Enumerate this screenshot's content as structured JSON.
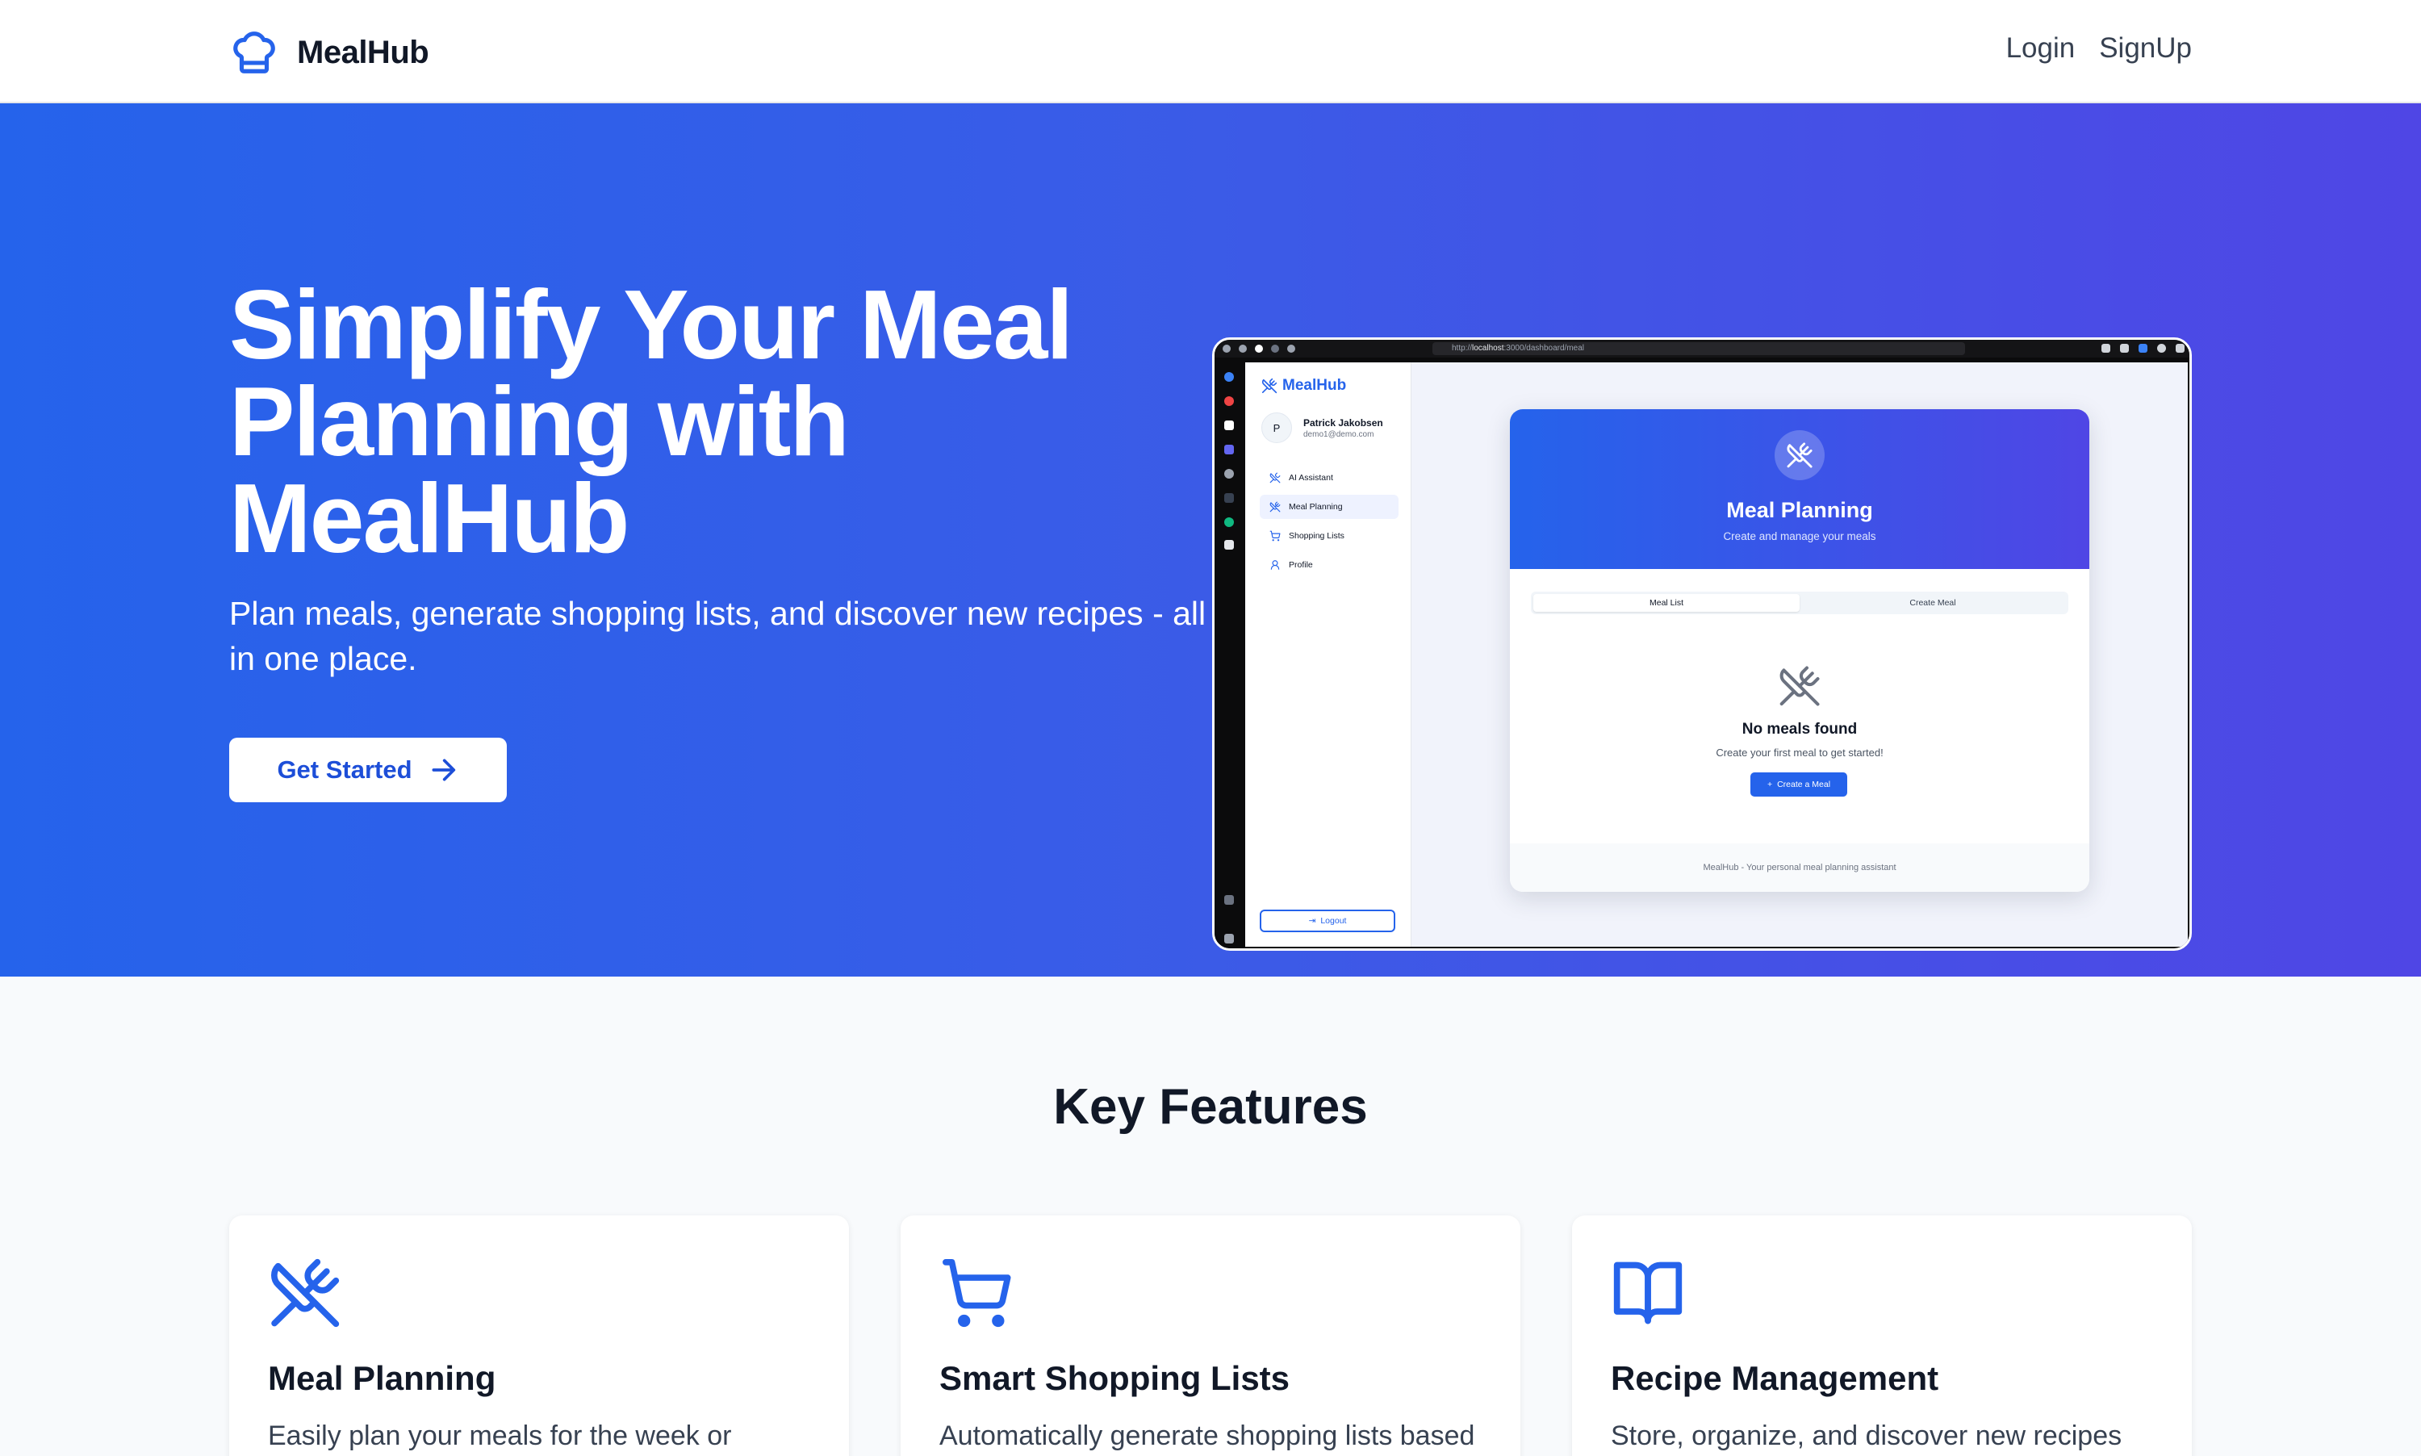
{
  "nav": {
    "brand": "MealHub",
    "login": "Login",
    "signup": "SignUp"
  },
  "hero": {
    "title": "Simplify Your Meal Planning with MealHub",
    "subtitle": "Plan meals, generate shopping lists, and discover new recipes - all in one place.",
    "cta": "Get Started"
  },
  "mock": {
    "url_prefix": "http://",
    "url_host": "localhost",
    "url_path": ":3000/dashboard/meal",
    "app_brand": "MealHub",
    "user_initial": "P",
    "user_name": "Patrick Jakobsen",
    "user_email": "demo1@demo.com",
    "nav_items": [
      {
        "label": "AI Assistant",
        "icon": "sparkles-icon"
      },
      {
        "label": "Meal Planning",
        "icon": "utensils-icon"
      },
      {
        "label": "Shopping Lists",
        "icon": "cart-icon"
      },
      {
        "label": "Profile",
        "icon": "user-icon"
      }
    ],
    "logout": "Logout",
    "card": {
      "title": "Meal Planning",
      "subtitle": "Create and manage your meals",
      "tab1": "Meal List",
      "tab2": "Create Meal",
      "empty_title": "No meals found",
      "empty_sub": "Create your first meal to get started!",
      "create_button": "Create a Meal",
      "footer": "MealHub - Your personal meal planning assistant"
    }
  },
  "features": {
    "title": "Key Features",
    "items": [
      {
        "title": "Meal Planning",
        "desc": "Easily plan your meals for the week or",
        "icon": "utensils-icon"
      },
      {
        "title": "Smart Shopping Lists",
        "desc": "Automatically generate shopping lists based",
        "icon": "cart-icon"
      },
      {
        "title": "Recipe Management",
        "desc": "Store, organize, and discover new recipes",
        "icon": "book-icon"
      }
    ]
  },
  "colors": {
    "primary": "#2563eb",
    "gradient_start": "#2563eb",
    "gradient_end": "#4f46e5"
  }
}
